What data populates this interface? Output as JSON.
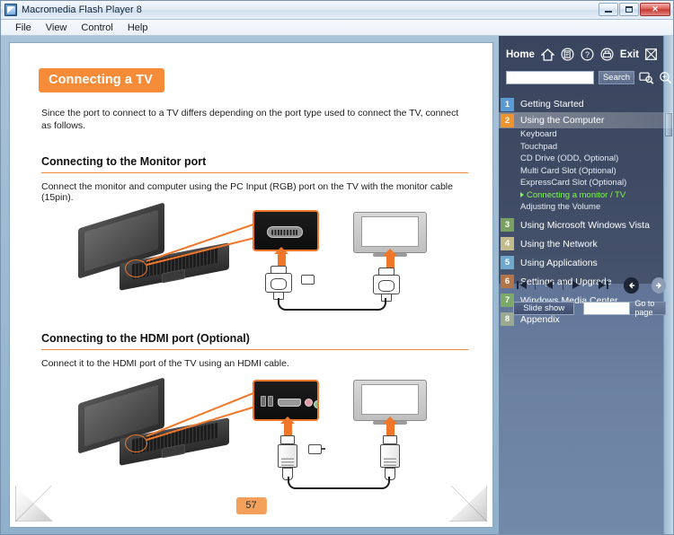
{
  "window": {
    "title": "Macromedia Flash Player 8",
    "app_icon": "flash-icon",
    "buttons": {
      "minimize": "minimize-icon",
      "maximize": "maximize-icon",
      "close": "✕"
    },
    "menus": [
      "File",
      "View",
      "Control",
      "Help"
    ]
  },
  "document": {
    "title": "Connecting a TV",
    "intro": "Since the port to connect to a TV differs depending on the port type used to connect the TV, connect as follows.",
    "sections": [
      {
        "heading": "Connecting to the Monitor port",
        "text": "Connect the monitor and computer using the PC Input (RGB) port on the TV with the monitor cable (15pin)."
      },
      {
        "heading": "Connecting to the HDMI port (Optional)",
        "text": "Connect it to the HDMI port of the TV using an HDMI cable."
      }
    ],
    "page_number": "57"
  },
  "sidebar": {
    "home_label": "Home",
    "exit_label": "Exit",
    "icons": [
      "home-icon",
      "contents-icon",
      "help-icon",
      "print-icon",
      "exit-icon",
      "find-icon",
      "zoom-icon"
    ],
    "search": {
      "value": "",
      "placeholder": "",
      "button_label": "Search"
    },
    "toc": [
      {
        "num": "1",
        "label": "Getting Started",
        "color": "#5b9bd5",
        "active": false,
        "children": []
      },
      {
        "num": "2",
        "label": "Using the Computer",
        "color": "#f0952e",
        "active": true,
        "children": [
          {
            "label": "Keyboard",
            "current": false
          },
          {
            "label": "Touchpad",
            "current": false
          },
          {
            "label": "CD Drive (ODD, Optional)",
            "current": false
          },
          {
            "label": "Multi Card Slot (Optional)",
            "current": false
          },
          {
            "label": "ExpressCard Slot (Optional)",
            "current": false
          },
          {
            "label": "Connecting a monitor / TV",
            "current": true
          },
          {
            "label": "Adjusting the Volume",
            "current": false
          }
        ]
      },
      {
        "num": "3",
        "label": "Using Microsoft Windows Vista",
        "color": "#7aa161",
        "active": false,
        "children": []
      },
      {
        "num": "4",
        "label": "Using the Network",
        "color": "#c3bd8e",
        "active": false,
        "children": []
      },
      {
        "num": "5",
        "label": "Using Applications",
        "color": "#6fa8cf",
        "active": false,
        "children": []
      },
      {
        "num": "6",
        "label": "Settings and Upgrade",
        "color": "#b2754a",
        "active": false,
        "children": []
      },
      {
        "num": "7",
        "label": "Windows Media Center",
        "color": "#7ca86a",
        "active": false,
        "children": []
      },
      {
        "num": "8",
        "label": "Appendix",
        "color": "#9aa98f",
        "active": false,
        "children": []
      }
    ],
    "player": {
      "first_label": "first-page-icon",
      "prev_label": "previous-page-icon",
      "next_label": "next-page-icon",
      "last_label": "last-page-icon",
      "back_label": "back-arrow-icon",
      "forward_label": "forward-arrow-icon",
      "slideshow_label": "Slide show",
      "goto_value": "",
      "goto_label": "Go to page"
    }
  },
  "colors": {
    "accent_orange": "#f68b38",
    "sidebar_dark": "#3e4a63",
    "sidebar_light": "#6b80a0",
    "highlight_green": "#7dfa4a"
  }
}
